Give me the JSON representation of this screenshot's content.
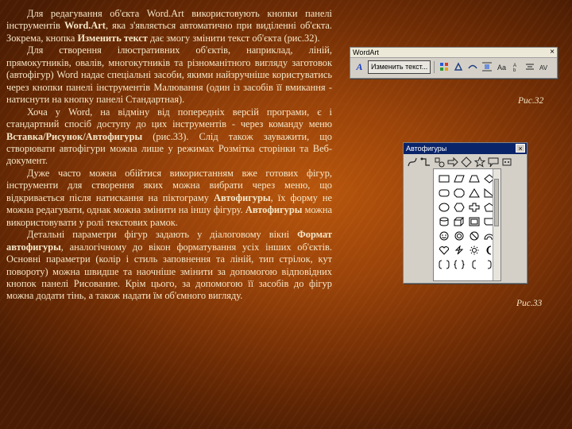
{
  "paragraphs": [
    {
      "segments": [
        {
          "t": "Для редагування об'єкта Word.Art використовують кнопки панелі інструментів ",
          "b": false
        },
        {
          "t": "Word.Art",
          "b": true
        },
        {
          "t": ", яка з'являється автоматично при виділенні об'єкта. Зокрема, кнопка ",
          "b": false
        },
        {
          "t": "Изменить текст",
          "b": true
        },
        {
          "t": " дає змогу змінити текст об'єкта (рис.32).",
          "b": false
        }
      ]
    },
    {
      "segments": [
        {
          "t": "Для створення ілюстративних об'єктів, наприклад, ліній, прямокутників, овалів, многокутників та різноманітного вигляду заготовок (автофігур) Word надає спеціальні засоби, якими найзручніше користуватись через кнопки панелі інструментів Малювання (один із засобів її вмикання - натиснути на кнопку панелі Стандартная).",
          "b": false
        }
      ]
    },
    {
      "segments": [
        {
          "t": "Хоча у Word, на відміну від попередніх версій програми, є і стандартний спосіб доступу до цих інструментів - через команду меню ",
          "b": false
        },
        {
          "t": "Вставка/Рисунок/Автофигуры",
          "b": true
        },
        {
          "t": " (рис.33). Слід також зауважити, що створювати автофігури можна лише у режимах Розмітка сторінки та Веб-документ.",
          "b": false
        }
      ]
    },
    {
      "segments": [
        {
          "t": "Дуже часто можна обійтися використанням вже готових фігур, інструменти для створення яких можна вибрати через меню, що відкривається після натискання на піктограму ",
          "b": false
        },
        {
          "t": "Автофигуры",
          "b": true
        },
        {
          "t": ", їх форму не можна редагувати, однак можна змінити на іншу фігуру. ",
          "b": false
        },
        {
          "t": "Автофигуры",
          "b": true
        },
        {
          "t": " можна використовувати у ролі текстових рамок.",
          "b": false
        }
      ]
    },
    {
      "segments": [
        {
          "t": "Детальні параметри фігур задають у діалоговому вікні ",
          "b": false
        },
        {
          "t": "Формат автофигуры",
          "b": true
        },
        {
          "t": ", аналогічному до вікон форматування усіх інших об'єктів. Основні параметри (колір і стиль заповнення та ліній, тип стрілок, кут повороту) можна швидше та наочніше змінити за допомогою відповідних кнопок панелі Рисование. Крім цього, за допомогою її засобів до фігур можна додати тінь, а також надати їм об'ємного вигляду.",
          "b": false
        }
      ]
    }
  ],
  "wordart_toolbar": {
    "title": "WordArt",
    "close_glyph": "×",
    "logo_glyph": "A",
    "edit_text_label": "Изменить текст...",
    "icons": [
      "gallery-icon",
      "format-icon",
      "shape-icon",
      "wrap-icon",
      "same-height-icon",
      "vertical-text-icon",
      "align-icon",
      "spacing-icon"
    ]
  },
  "autoshapes_palette": {
    "title": "Автофигуры",
    "close_glyph": "×",
    "categories": [
      "lines-icon",
      "connectors-icon",
      "basic-shapes-icon",
      "block-arrows-icon",
      "flowchart-icon",
      "stars-icon",
      "callouts-icon",
      "more-icon"
    ]
  },
  "captions": {
    "fig32": "Рис.32",
    "fig33": "Рис.33"
  }
}
